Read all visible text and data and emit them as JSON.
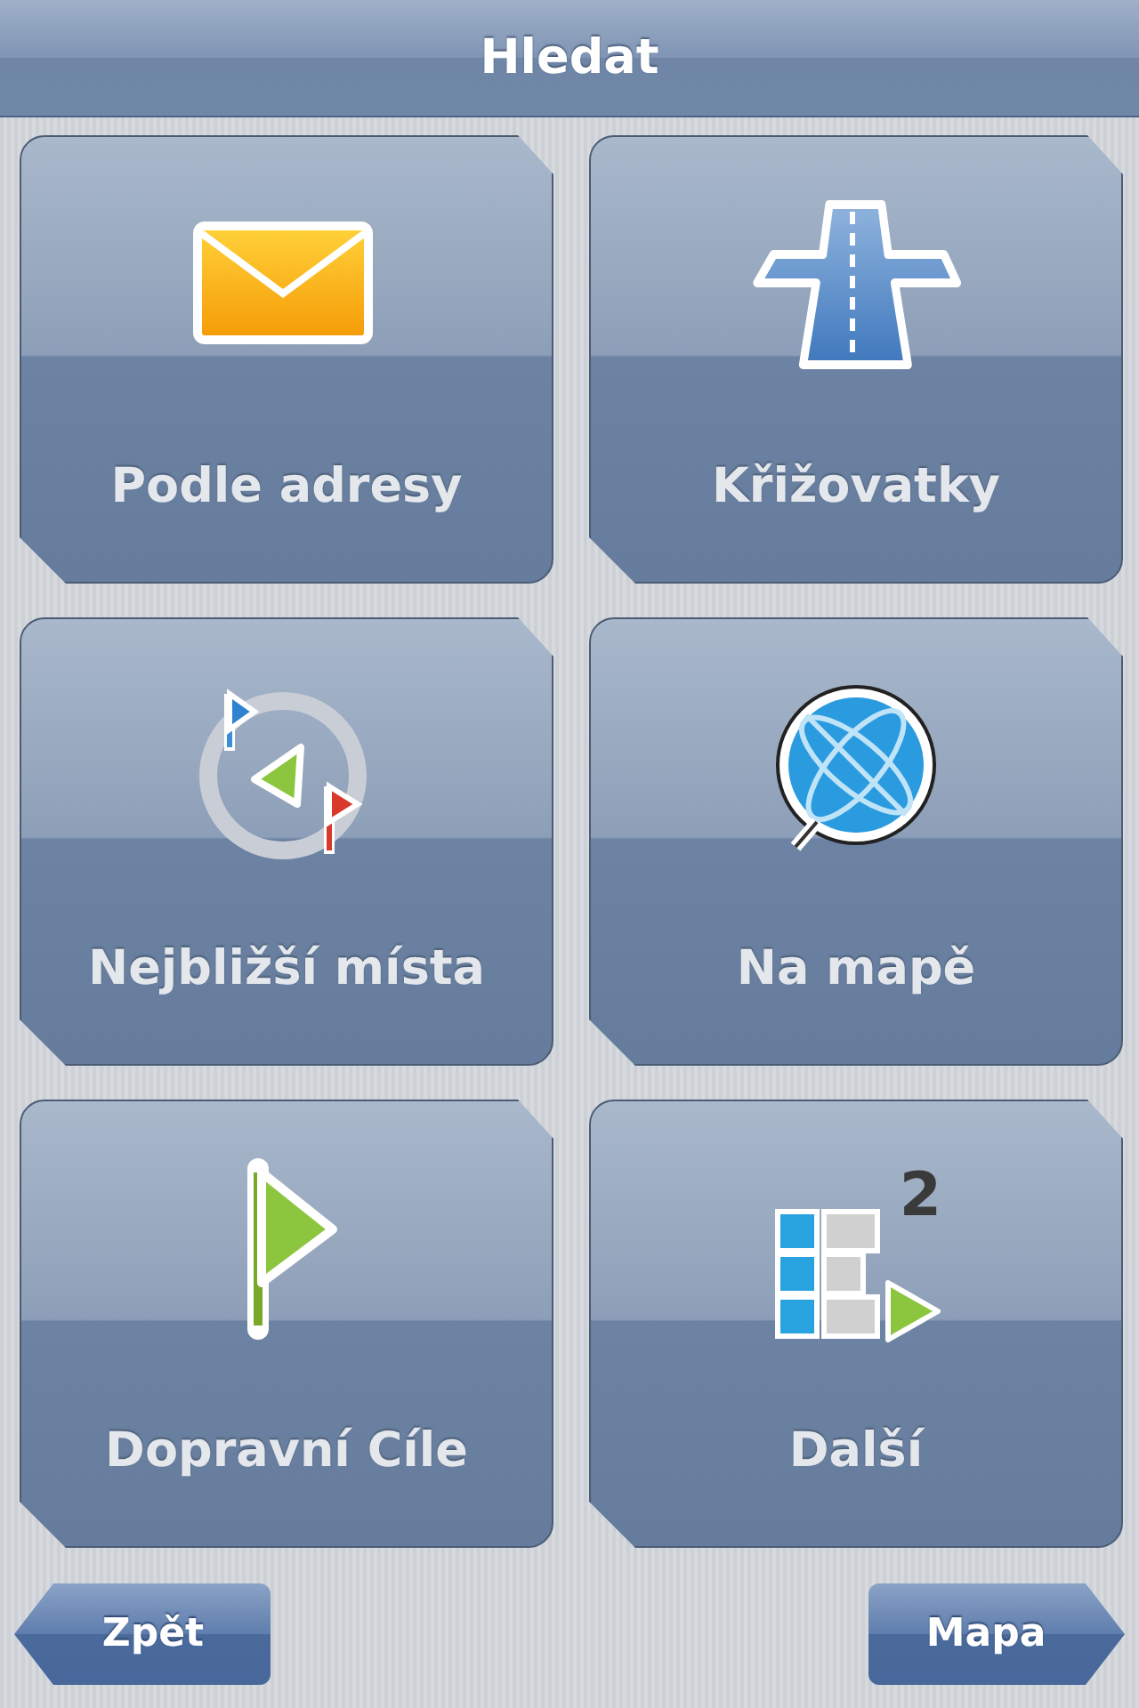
{
  "header": {
    "title": "Hledat"
  },
  "tiles": [
    {
      "label": "Podle adresy",
      "kind": "envelope"
    },
    {
      "label": "Křižovatky",
      "kind": "highway"
    },
    {
      "label": "Nejbližší místa",
      "kind": "nearby"
    },
    {
      "label": "Na mapě",
      "kind": "globe"
    },
    {
      "label": "Dopravní Cíle",
      "kind": "flag"
    },
    {
      "label": "Další",
      "kind": "more"
    }
  ],
  "more_icon_number": "2",
  "buttons": [
    {
      "label": "Zpět",
      "kind": "back"
    },
    {
      "label": "Mapa",
      "kind": "forward"
    }
  ]
}
